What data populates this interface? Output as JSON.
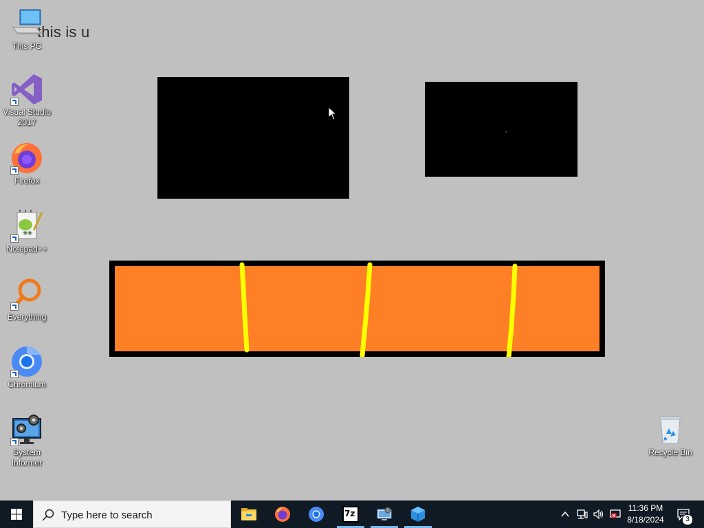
{
  "desktop": {
    "overlay_text": "this is u",
    "icons": [
      {
        "label": "This PC",
        "icon": "computer-icon"
      },
      {
        "label": "Visual Studio 2017",
        "icon": "visual-studio-icon"
      },
      {
        "label": "Firefox",
        "icon": "firefox-icon"
      },
      {
        "label": "Notepad++",
        "icon": "notepad-plus-plus-icon"
      },
      {
        "label": "Everything",
        "icon": "everything-search-icon"
      },
      {
        "label": "Chromium",
        "icon": "chromium-icon"
      },
      {
        "label": "System Informer",
        "icon": "system-informer-icon"
      },
      {
        "label": "Recycle Bin",
        "icon": "recycle-bin-icon"
      }
    ],
    "colors": {
      "background": "#c0c0c0",
      "bar_fill": "#ff7f27",
      "stripe": "#ffff00"
    }
  },
  "taskbar": {
    "search_placeholder": "Type here to search",
    "apps": [
      {
        "name": "File Explorer",
        "icon": "file-explorer-icon"
      },
      {
        "name": "Firefox",
        "icon": "firefox-icon"
      },
      {
        "name": "Chromium",
        "icon": "chromium-icon"
      },
      {
        "name": "7-Zip",
        "icon": "seven-zip-icon",
        "glyph_text": "7z"
      },
      {
        "name": "Remote app",
        "icon": "remote-desktop-icon"
      },
      {
        "name": "App",
        "icon": "app-icon"
      }
    ],
    "clock": {
      "time": "11:36 PM",
      "date": "8/18/2024"
    },
    "notification_count": "3"
  }
}
